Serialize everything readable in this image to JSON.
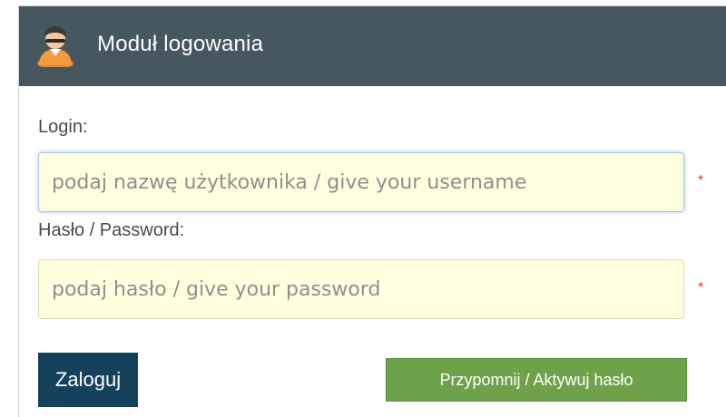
{
  "header": {
    "title": "Moduł logowania",
    "icon": "user-avatar-icon"
  },
  "form": {
    "login_label": "Login:",
    "login_placeholder": "podaj nazwę użytkownika / give your username",
    "login_value": "",
    "password_label": "Hasło / Password:",
    "password_placeholder": "podaj hasło / give your password",
    "password_value": "",
    "required_marker": "*"
  },
  "buttons": {
    "login_label": "Zaloguj",
    "remind_label": "Przypomnij / Aktywuj hasło"
  },
  "colors": {
    "header_bg": "#47575f",
    "input_bg": "#ffffe0",
    "login_button_bg": "#16415d",
    "remind_button_bg": "#6ea24a",
    "required_color": "#d9342b"
  }
}
